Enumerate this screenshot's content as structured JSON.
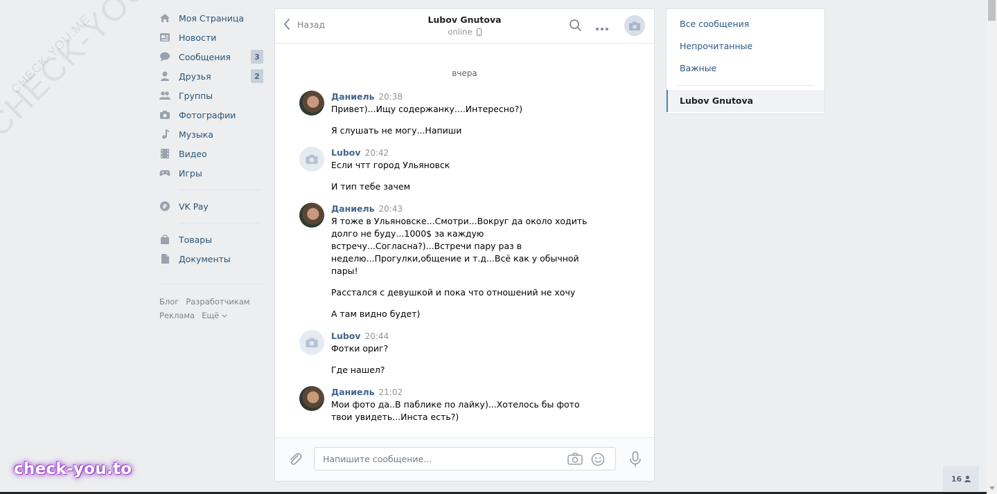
{
  "watermark": {
    "big": "CHECK-YOU.ME",
    "small": "CHECK-YOU.ME",
    "logo": "check-you.to"
  },
  "nav": {
    "items": [
      {
        "label": "Моя Страница",
        "icon": "home-icon"
      },
      {
        "label": "Новости",
        "icon": "news-icon"
      },
      {
        "label": "Сообщения",
        "icon": "messages-icon",
        "badge": "3"
      },
      {
        "label": "Друзья",
        "icon": "friends-icon",
        "badge": "2"
      },
      {
        "label": "Группы",
        "icon": "groups-icon"
      },
      {
        "label": "Фотографии",
        "icon": "photos-icon"
      },
      {
        "label": "Музыка",
        "icon": "music-icon"
      },
      {
        "label": "Видео",
        "icon": "video-icon"
      },
      {
        "label": "Игры",
        "icon": "games-icon"
      },
      {
        "label": "VK Pay",
        "icon": "vkpay-icon"
      },
      {
        "label": "Товары",
        "icon": "goods-icon"
      },
      {
        "label": "Документы",
        "icon": "documents-icon"
      }
    ],
    "footer": [
      "Блог",
      "Разработчикам",
      "Реклама",
      "Ещё"
    ]
  },
  "chat": {
    "back_label": "Назад",
    "name": "Lubov Gnutova",
    "status": "online",
    "day_divider": "вчера",
    "messages": [
      {
        "author": "Даниель",
        "time": "20:38",
        "avatar": "photo",
        "texts": [
          "Привет)...Ищу содержанку....Интересно?)",
          "Я слушать не могу...Напиши"
        ]
      },
      {
        "author": "Lubov",
        "time": "20:42",
        "avatar": "camera",
        "texts": [
          "Если чтт город Ульяновск",
          "И тип тебе зачем"
        ]
      },
      {
        "author": "Даниель",
        "time": "20:43",
        "avatar": "photo",
        "texts": [
          "Я тоже в Ульяновске...Смотри...Вокруг да около ходить долго не буду...1000$ за каждую встречу...Согласна?)...Встречи пару раз в неделю...Прогулки,общение и т.д...Всё как у обычной пары!",
          "Расстался с девушкой и пока что отношений не хочу",
          "А там видно будет)"
        ]
      },
      {
        "author": "Lubov",
        "time": "20:44",
        "avatar": "camera",
        "texts": [
          "Фотки ориг?",
          "Где нашел?"
        ]
      },
      {
        "author": "Даниель",
        "time": "21:02",
        "avatar": "photo",
        "texts": [
          "Мои фото да..В паблике по лайку)...Хотелось бы фото твои увидеть...Инста есть?)"
        ]
      }
    ],
    "composer": {
      "placeholder": "Напишите сообщение..."
    }
  },
  "right_panel": {
    "items": [
      "Все сообщения",
      "Непрочитанные",
      "Важные"
    ],
    "active": "Lubov Gnutova"
  },
  "online_count": "16",
  "colors": {
    "link": "#2a5885",
    "author": "#42648b",
    "bg": "#edeef0",
    "accent": "#5181b8"
  }
}
